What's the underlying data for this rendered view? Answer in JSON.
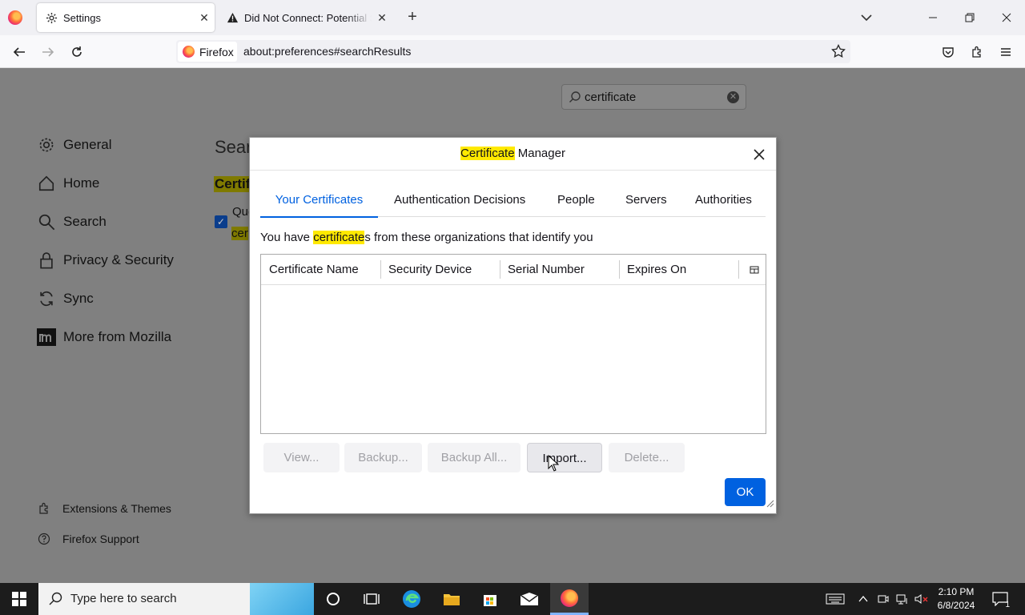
{
  "browser": {
    "tabs": [
      {
        "label": "Settings",
        "icon": "gear-icon",
        "active": true
      },
      {
        "label": "Did Not Connect: Potential Security Issue",
        "icon": "warning-icon",
        "active": false
      }
    ],
    "identity_label": "Firefox",
    "url": "about:preferences#searchResults"
  },
  "settings": {
    "search_value": "certificate",
    "sidebar": [
      {
        "label": "General",
        "icon": "gear-icon"
      },
      {
        "label": "Home",
        "icon": "home-icon"
      },
      {
        "label": "Search",
        "icon": "search-icon"
      },
      {
        "label": "Privacy & Security",
        "icon": "lock-icon"
      },
      {
        "label": "Sync",
        "icon": "sync-icon"
      },
      {
        "label": "More from Mozilla",
        "icon": "mozilla-icon"
      }
    ],
    "footer_links": [
      {
        "label": "Extensions & Themes",
        "icon": "puzzle-icon"
      },
      {
        "label": "Firefox Support",
        "icon": "help-icon"
      }
    ],
    "bg_heading": "Searc",
    "bg_cert": "Certif",
    "bg_que": "Que",
    "bg_cer": "cer"
  },
  "dialog": {
    "title_highlight": "Certificate",
    "title_rest": " Manager",
    "tabs": [
      "Your Certificates",
      "Authentication Decisions",
      "People",
      "Servers",
      "Authorities"
    ],
    "selected_tab": "Your Certificates",
    "desc_pre": "You have ",
    "desc_highlight": "certificate",
    "desc_post": "s from these organizations that identify you",
    "columns": [
      "Certificate Name",
      "Security Device",
      "Serial Number",
      "Expires On"
    ],
    "buttons": {
      "view": "View...",
      "backup": "Backup...",
      "backup_all": "Backup All...",
      "import": "Import...",
      "delete": "Delete..."
    },
    "ok": "OK"
  },
  "taskbar": {
    "search_placeholder": "Type here to search",
    "time": "2:10 PM",
    "date": "6/8/2024",
    "notification_count": "1"
  },
  "colors": {
    "accent": "#0061e0",
    "highlight": "#ffe900"
  }
}
